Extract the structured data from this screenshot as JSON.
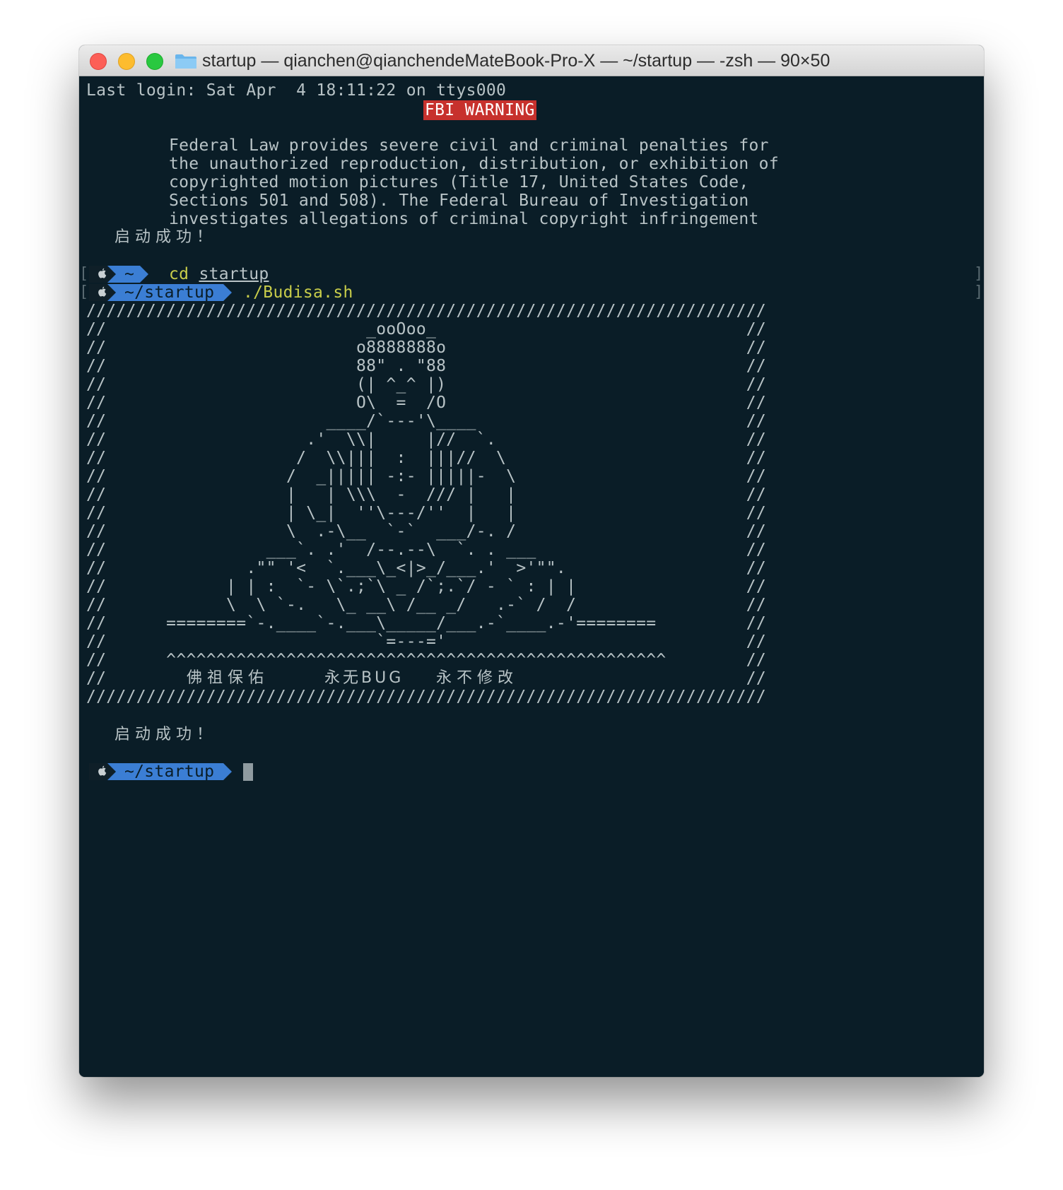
{
  "window": {
    "title": "startup — qianchen@qianchendeMateBook-Pro-X — ~/startup — -zsh — 90×50"
  },
  "terminal": {
    "last_login": "Last login: Sat Apr  4 18:11:22 on ttys000",
    "fbi_warning": "FBI WARNING",
    "warning_lines": [
      "Federal Law provides severe civil and criminal penalties for",
      "the unauthorized reproduction, distribution, or exhibition of",
      "copyrighted motion pictures (Title 17, United States Code,",
      "Sections 501 and 508). The Federal Bureau of Investigation",
      "investigates allegations of criminal copyright infringement"
    ],
    "startup_success": "启动成功！",
    "prompts": [
      {
        "left_bracket": "[",
        "dir": "~",
        "command": "cd",
        "arg": "startup",
        "right_bracket": "]"
      },
      {
        "left_bracket": "[",
        "dir": "~/startup",
        "command": "./Budisa.sh",
        "right_bracket": "]"
      }
    ],
    "banner_lines": [
      "////////////////////////////////////////////////////////////////////",
      "//                          _ooOoo_                               //",
      "//                         o8888888o                              //",
      "//                         88\" . \"88                              //",
      "//                         (| ^_^ |)                              //",
      "//                         O\\  =  /O                              //",
      "//                      ____/`---'\\____                           //",
      "//                    .'  \\\\|     |//  `.                         //",
      "//                   /  \\\\|||  :  |||//  \\                        //",
      "//                  /  _||||| -:- |||||-  \\                       //",
      "//                  |   | \\\\\\  -  /// |   |                       //",
      "//                  | \\_|  ''\\---/''  |   |                       //",
      "//                  \\  .-\\__  `-`  ___/-. /                       //",
      "//                ___`. .'  /--.--\\  `. . ___                     //",
      "//              .\"\" '<  `.___\\_<|>_/___.'  >'\"\".                  //",
      "//            | | :  `- \\`.;`\\ _ /`;.`/ - ` : | |                 //",
      "//            \\  \\ `-.   \\_ __\\ /__ _/   .-` /  /                 //",
      "//      ========`-.____`-.___\\_____/___.-`____.-'========         //",
      "//                           `=---='                              //",
      "//      ^^^^^^^^^^^^^^^^^^^^^^^^^^^^^^^^^^^^^^^^^^^^^^^^^^        //",
      "//                                                                //",
      "////////////////////////////////////////////////////////////////////"
    ],
    "blessing": [
      "佛祖保佑",
      "永无BUG",
      "永不修改"
    ],
    "startup_success_2": "启动成功！",
    "current_prompt_dir": "~/startup"
  },
  "colors": {
    "terminal_bg": "#0a1d27",
    "text": "#b8c3c6",
    "fbi_bg": "#c7312d",
    "prompt_dir_bg": "#3b7ed4",
    "command": "#c8cd4a"
  },
  "icons": [
    "folder-icon",
    "apple-icon"
  ]
}
